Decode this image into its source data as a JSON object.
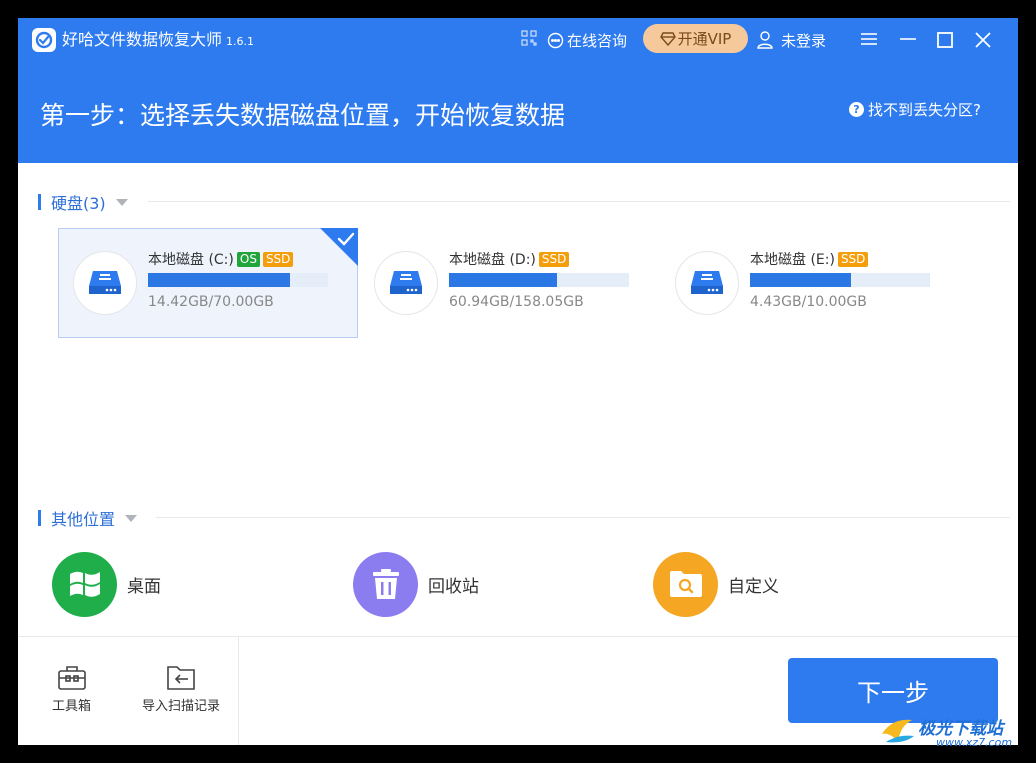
{
  "app": {
    "title": "好哈文件数据恢复大师",
    "version": "1.6.1"
  },
  "header": {
    "consult_label": "在线咨询",
    "vip_label": "开通VIP",
    "login_label": "未登录",
    "step_title": "第一步：选择丢失数据磁盘位置，开始恢复数据",
    "help_label": "找不到丢失分区?"
  },
  "disks_section": {
    "label": "硬盘(3)",
    "disks": [
      {
        "name": "本地磁盘 (C:)",
        "badges": [
          "OS",
          "SSD"
        ],
        "size": "14.42GB/70.00GB",
        "used_fraction": 0.79,
        "selected": true
      },
      {
        "name": "本地磁盘 (D:)",
        "badges": [
          "SSD"
        ],
        "size": "60.94GB/158.05GB",
        "used_fraction": 0.6,
        "selected": false
      },
      {
        "name": "本地磁盘 (E:)",
        "badges": [
          "SSD"
        ],
        "size": "4.43GB/10.00GB",
        "used_fraction": 0.56,
        "selected": false
      }
    ]
  },
  "other_section": {
    "label": "其他位置",
    "locations": [
      {
        "label": "桌面",
        "icon": "windows-icon",
        "color": "#1fae4a"
      },
      {
        "label": "回收站",
        "icon": "trash-icon",
        "color": "#8b7cf0"
      },
      {
        "label": "自定义",
        "icon": "folder-search-icon",
        "color": "#f5a623"
      }
    ]
  },
  "footer": {
    "toolbox_label": "工具箱",
    "import_label": "导入扫描记录",
    "next_label": "下一步"
  },
  "watermark": {
    "text": "极光下载站",
    "url": "www.xz7.com"
  },
  "colors": {
    "primary": "#2e7bf0",
    "vip": "#f5c99b",
    "os_badge": "#21a53b",
    "ssd_badge": "#f59e0b"
  }
}
